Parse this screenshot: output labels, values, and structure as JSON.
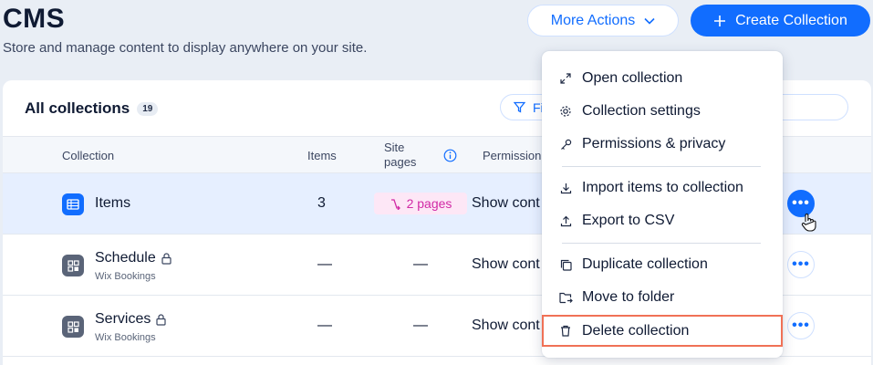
{
  "header": {
    "title": "CMS",
    "subtitle": "Store and manage content to display anywhere on your site.",
    "more_actions_label": "More Actions",
    "create_label": "Create Collection"
  },
  "collections_panel": {
    "title": "All collections",
    "count": "19",
    "filter_label": "Fi"
  },
  "table": {
    "columns": {
      "collection": "Collection",
      "items": "Items",
      "site_pages": "Site pages",
      "permissions": "Permission"
    },
    "rows": [
      {
        "name": "Items",
        "sub": "",
        "items": "3",
        "pages": "2 pages",
        "permissions": "Show cont",
        "icon": "table-icon",
        "locked": false
      },
      {
        "name": "Schedule",
        "sub": "Wix Bookings",
        "items": "—",
        "pages": "—",
        "permissions": "Show cont",
        "icon": "app-grid-icon",
        "locked": true
      },
      {
        "name": "Services",
        "sub": "Wix Bookings",
        "items": "—",
        "pages": "—",
        "permissions": "Show cont",
        "icon": "app-grid-icon",
        "locked": true
      }
    ],
    "more_button_glyph": "•••"
  },
  "context_menu": {
    "items": [
      {
        "label": "Open collection",
        "icon": "expand-icon"
      },
      {
        "label": "Collection settings",
        "icon": "gear-icon"
      },
      {
        "label": "Permissions & privacy",
        "icon": "key-icon"
      },
      {
        "label": "Import items to collection",
        "icon": "download-icon"
      },
      {
        "label": "Export to CSV",
        "icon": "upload-icon"
      },
      {
        "label": "Duplicate collection",
        "icon": "duplicate-icon"
      },
      {
        "label": "Move to folder",
        "icon": "folder-move-icon"
      },
      {
        "label": "Delete collection",
        "icon": "trash-icon"
      }
    ]
  },
  "colors": {
    "accent": "#116dff",
    "highlight_outline": "#f07156",
    "pages_badge": "#d12aa5"
  }
}
